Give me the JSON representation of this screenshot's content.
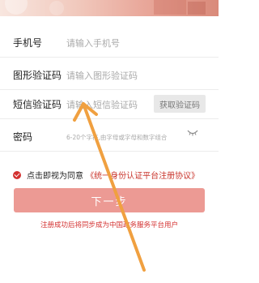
{
  "form": {
    "phone": {
      "label": "手机号",
      "placeholder": "请输入手机号"
    },
    "captcha": {
      "label": "图形验证码",
      "placeholder": "请输入图形验证码"
    },
    "sms": {
      "label": "短信验证码",
      "placeholder": "请输入短信验证码",
      "button": "获取验证码"
    },
    "password": {
      "label": "密码",
      "placeholder": "6-20个字符,由字母或字母和数字组合"
    }
  },
  "agreement": {
    "prefix": "点击即视为同意",
    "link": "《统一身份认证平台注册协议》"
  },
  "next_button": "下一步",
  "notice": "注册成功后将同步成为中国政务服务平台用户",
  "colors": {
    "accent": "#d3302f",
    "button_disabled": "#ec9a94",
    "arrow": "#f0a040"
  },
  "icons": [
    "eye-closed-icon",
    "checked-circle-icon",
    "pointer-arrow-icon"
  ]
}
